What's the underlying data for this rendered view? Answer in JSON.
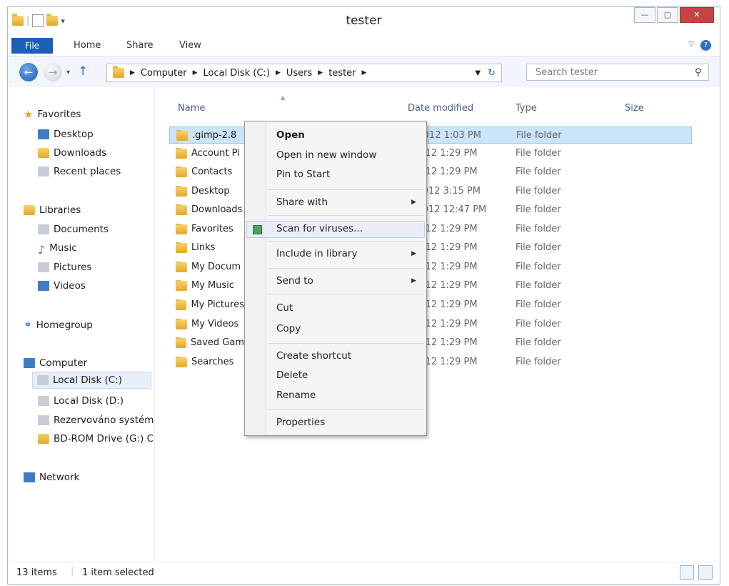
{
  "window": {
    "title": "tester"
  },
  "ribbon": {
    "file": "File",
    "home": "Home",
    "share": "Share",
    "view": "View"
  },
  "address": {
    "crumbs": [
      "Computer",
      "Local Disk (C:)",
      "Users",
      "tester"
    ],
    "search_placeholder": "Search tester"
  },
  "nav": {
    "favorites": "Favorites",
    "desktop": "Desktop",
    "downloads": "Downloads",
    "recent": "Recent places",
    "libraries": "Libraries",
    "documents": "Documents",
    "music": "Music",
    "pictures": "Pictures",
    "videos": "Videos",
    "homegroup": "Homegroup",
    "computer": "Computer",
    "local_c": "Local Disk (C:)",
    "local_d": "Local Disk (D:)",
    "reserved": "Rezervováno systém",
    "bdrom": "BD-ROM Drive (G:) C",
    "network": "Network"
  },
  "columns": {
    "name": "Name",
    "date": "Date modified",
    "type": "Type",
    "size": "Size"
  },
  "files": [
    {
      "name": ".gimp-2.8",
      "date": "/2012 1:03 PM",
      "type": "File folder"
    },
    {
      "name": "Account Pi",
      "date": "2012 1:29 PM",
      "type": "File folder"
    },
    {
      "name": "Contacts",
      "date": "2012 1:29 PM",
      "type": "File folder"
    },
    {
      "name": "Desktop",
      "date": "/2012 3:15 PM",
      "type": "File folder"
    },
    {
      "name": "Downloads",
      "date": "/2012 12:47 PM",
      "type": "File folder"
    },
    {
      "name": "Favorites",
      "date": "2012 1:29 PM",
      "type": "File folder"
    },
    {
      "name": "Links",
      "date": "2012 1:29 PM",
      "type": "File folder"
    },
    {
      "name": "My Docum",
      "date": "2012 1:29 PM",
      "type": "File folder"
    },
    {
      "name": "My Music",
      "date": "2012 1:29 PM",
      "type": "File folder"
    },
    {
      "name": "My Pictures",
      "date": "2012 1:29 PM",
      "type": "File folder"
    },
    {
      "name": "My Videos",
      "date": "2012 1:29 PM",
      "type": "File folder"
    },
    {
      "name": "Saved Gam",
      "date": "2012 1:29 PM",
      "type": "File folder"
    },
    {
      "name": "Searches",
      "date": "2012 1:29 PM",
      "type": "File folder"
    }
  ],
  "menu": {
    "open": "Open",
    "open_new": "Open in new window",
    "pin": "Pin to Start",
    "share": "Share with",
    "scan": "Scan for viruses...",
    "include": "Include in library",
    "send": "Send to",
    "cut": "Cut",
    "copy": "Copy",
    "shortcut": "Create shortcut",
    "delete": "Delete",
    "rename": "Rename",
    "properties": "Properties"
  },
  "status": {
    "items": "13 items",
    "selected": "1 item selected"
  }
}
